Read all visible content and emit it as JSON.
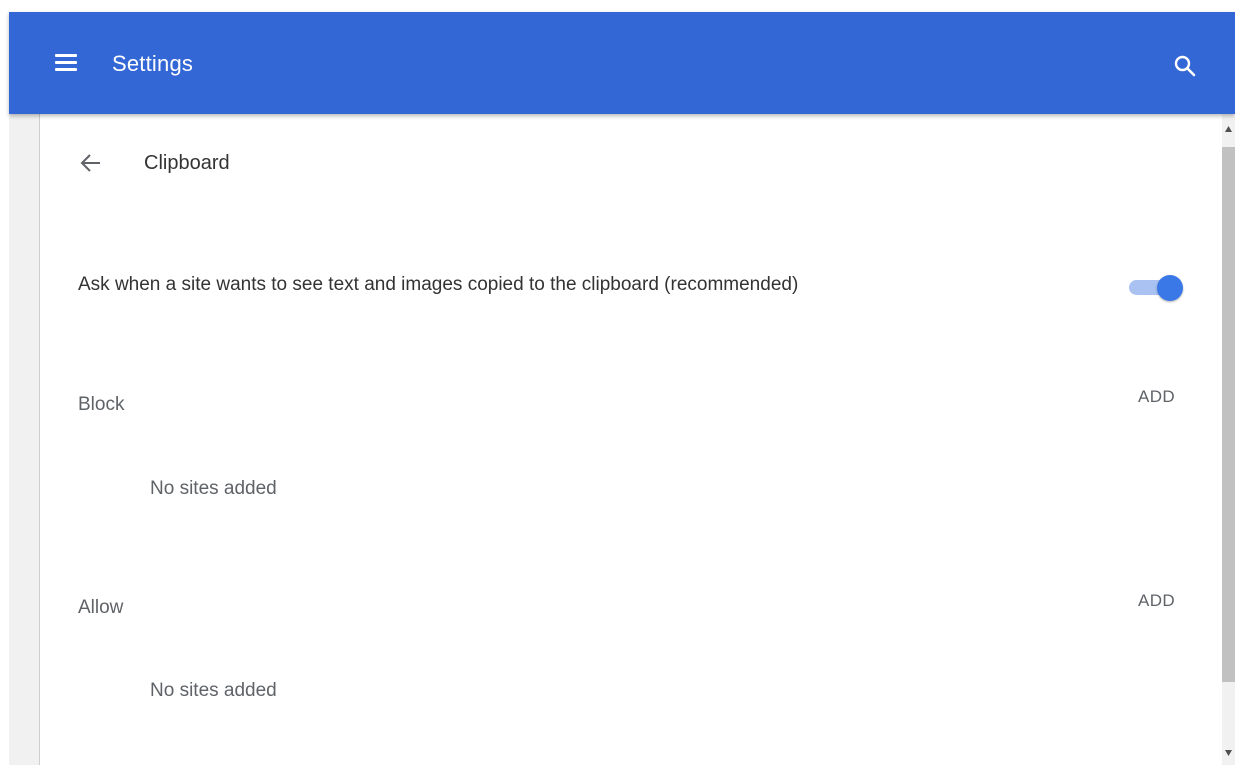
{
  "header": {
    "title": "Settings",
    "menu_icon": "hamburger-menu-icon",
    "search_icon": "search-icon",
    "background_color": "#3367d6"
  },
  "page": {
    "title": "Clipboard",
    "back_icon": "arrow-back-icon"
  },
  "ask_setting": {
    "label": "Ask when a site wants to see text and images copied to the clipboard (recommended)",
    "enabled": true,
    "accent_color": "#3b78e7"
  },
  "block": {
    "label": "Block",
    "add_label": "ADD",
    "empty_text": "No sites added"
  },
  "allow": {
    "label": "Allow",
    "add_label": "ADD",
    "empty_text": "No sites added"
  }
}
